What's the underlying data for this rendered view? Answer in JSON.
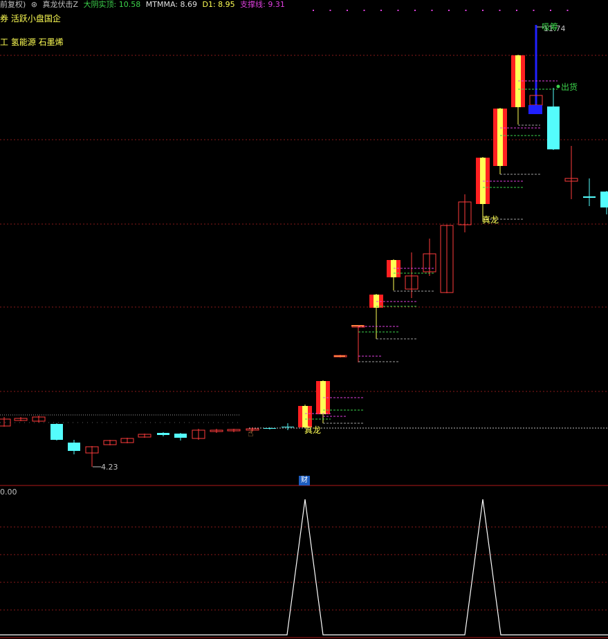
{
  "header": {
    "adjust_label": "前复权)",
    "indicator_name": "真龙伏击Z",
    "items": [
      {
        "label": "大阴实顶: 10.58",
        "color": "#3cd34b"
      },
      {
        "label": "MTMMA: 8.69",
        "color": "#e0e0e0"
      },
      {
        "label": "D1: 8.95",
        "color": "#ffff54"
      },
      {
        "label": "支撑线: 9.31",
        "color": "#e040e0"
      }
    ]
  },
  "tags": {
    "line1": "券 活跃小盘国企",
    "line2": "工 氢能源 石墨烯"
  },
  "annotations": {
    "low_label": "4.23",
    "high_label": "11.74",
    "top_label": "吸筹",
    "sell_label": "出货",
    "signal1": "真龙",
    "signal2": "真龙",
    "cai_badge": "财",
    "sub_axis_value": "0.00"
  },
  "chart_data": {
    "type": "candlestick",
    "low_marker": 4.23,
    "high_marker": 11.74,
    "sub_indicator": {
      "type": "line",
      "peaks_at_candles": [
        17,
        28
      ]
    }
  },
  "colors": {
    "up": "#ff3b3b",
    "down": "#54fcfc",
    "signal_red": "#ff2020",
    "signal_yellow": "#ffff54",
    "grid": "#8b1a1a",
    "blue_bar": "#2020ff"
  }
}
